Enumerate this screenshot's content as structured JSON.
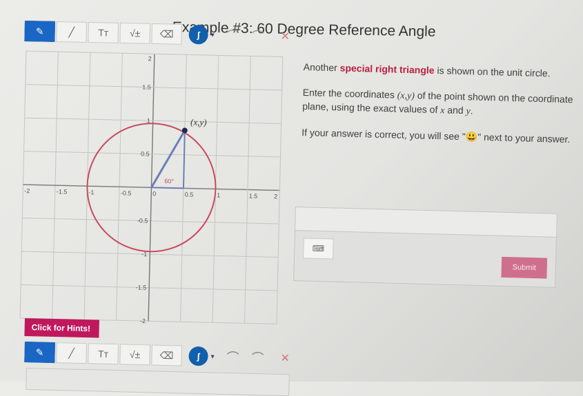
{
  "header": {
    "title": "Example #3: 60 Degree Reference Angle"
  },
  "toolbar": {
    "tools": [
      {
        "name": "pencil-tool",
        "icon": "✎",
        "active": true
      },
      {
        "name": "line-tool",
        "icon": "╱",
        "active": false
      },
      {
        "name": "text-tool",
        "icon": "Tт",
        "active": false
      },
      {
        "name": "math-tool",
        "icon": "√±",
        "active": false
      },
      {
        "name": "eraser-tool",
        "icon": "⌫",
        "active": false
      }
    ],
    "color_icon": "ʃ",
    "caret_icon": "▾",
    "undo_icon": "⌒",
    "redo_icon": "⌒",
    "clear_icon": "✕"
  },
  "graph": {
    "x_ticks": [
      "-2",
      "-1.5",
      "-1",
      "-0.5",
      "0",
      "0.5",
      "1",
      "1.5",
      "2"
    ],
    "y_ticks": [
      "2",
      "1.5",
      "1",
      "0.5",
      "-0.5",
      "-1",
      "-1.5",
      "-2"
    ],
    "point_label": "(x,y)",
    "angle_label": "60°",
    "angle_degrees": 60,
    "circle_radius": 1,
    "range": [
      -2,
      2
    ],
    "colors": {
      "circle": "#c94a5e",
      "triangle": "#6a7fb8",
      "grid": "#c4c4c4",
      "axis": "#777777"
    }
  },
  "hints_button": {
    "label": "Click for Hints!"
  },
  "instructions": {
    "p1_before": "Another ",
    "p1_highlight": "special right triangle",
    "p1_after": " is shown on the unit circle.",
    "p2_before": "Enter the coordinates ",
    "p2_math": "(x,y)",
    "p2_mid": " of the  point shown on the coordinate plane, using the exact values of ",
    "p2_math_x": "x",
    "p2_and": " and ",
    "p2_math_y": "y",
    "p2_end": ".",
    "p3_before": "If your answer is correct, you will see \"",
    "p3_emoji": "😃",
    "p3_after": "\" next to your answer."
  },
  "answer": {
    "value": "",
    "keyboard_icon": "⌨",
    "submit_label": "Submit"
  }
}
